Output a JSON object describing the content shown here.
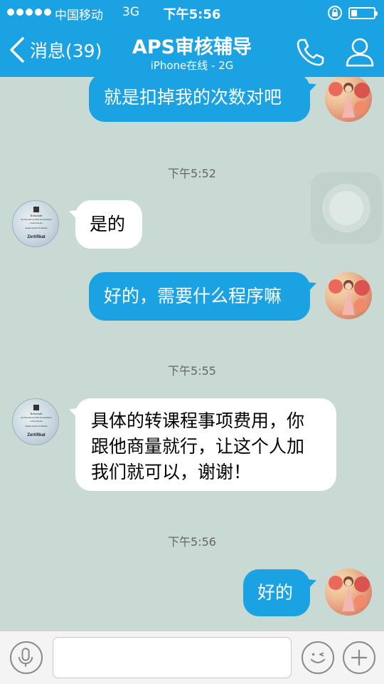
{
  "status_bar": {
    "carrier": "中国移动",
    "network": "3G",
    "time": "下午5:56",
    "battery_level": 0.25
  },
  "header": {
    "back_label": "消息(39)",
    "title": "APS审核辅导",
    "subtitle": "iPhone在线 - 2G",
    "icons": [
      "chevron-left-icon",
      "phone-icon",
      "person-icon"
    ]
  },
  "messages": {
    "m1": "就是扣掉我的次数对吧",
    "t1": "下午5:52",
    "m2": "是的",
    "m3": "好的，需要什么程序嘛",
    "t2": "下午5:55",
    "m4_line1": "具体的转课程事项费用，你",
    "m4_line2": "跟他商量就行，让这个人加",
    "m4_line3": "我们就可以，谢谢！",
    "t3": "下午5:56",
    "m5": "好的"
  },
  "contact_avatar": {
    "line1": "Botschaft",
    "line2": "der Bundesrepublik Deutschland",
    "line3": "– Kulturreferat –",
    "line4": "Akademische Prüfstelle",
    "badge": "Zertifikat"
  },
  "input_bar": {
    "placeholder": "",
    "icons": [
      "microphone-icon",
      "emoji-icon",
      "plus-icon"
    ]
  },
  "colors": {
    "accent": "#1aa2e2",
    "chat_background": "#c9d9d3",
    "incoming_bubble": "#ffffff"
  }
}
